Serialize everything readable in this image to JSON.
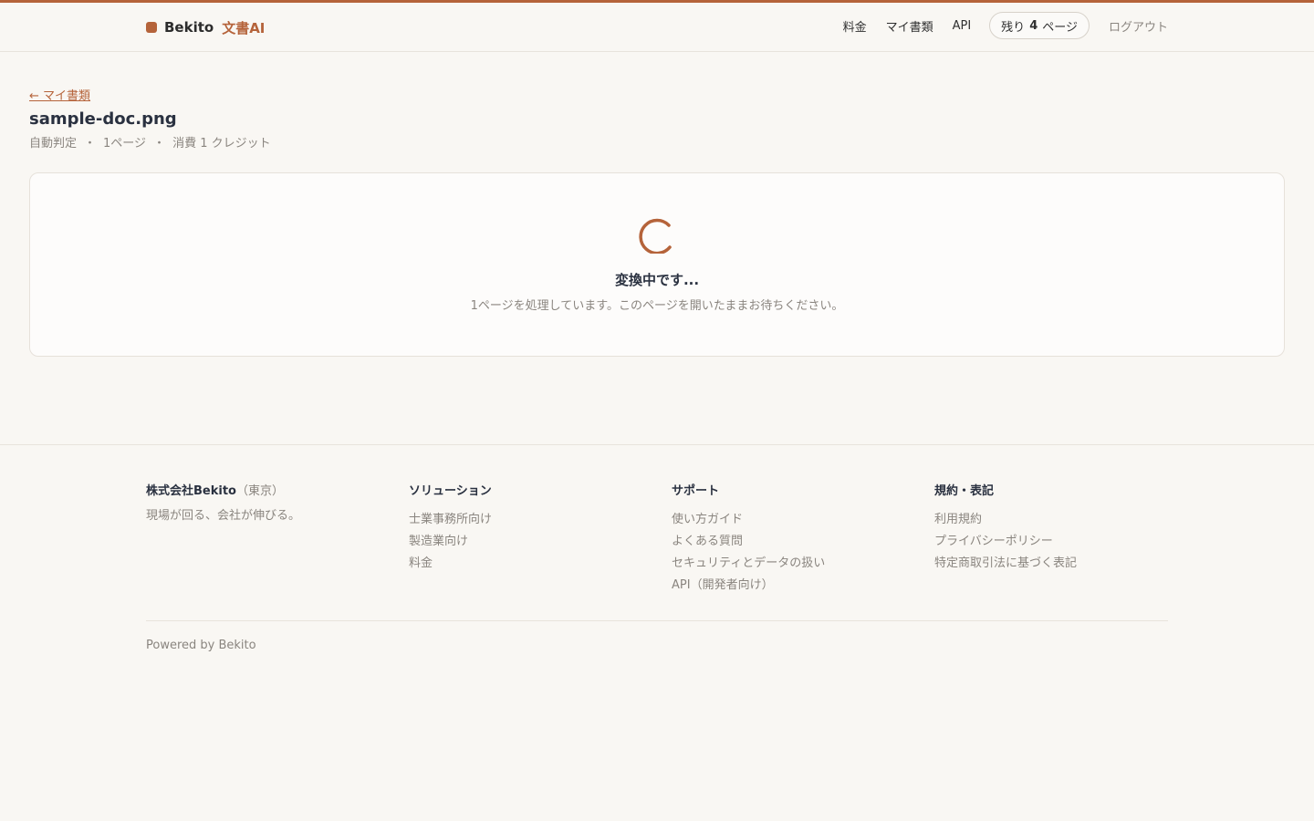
{
  "header": {
    "brand_name": "Bekito",
    "brand_sub": "文書AI",
    "nav": {
      "pricing": "料金",
      "my_docs": "マイ書類",
      "api": "API",
      "credits_prefix": "残り",
      "credits_count": "4",
      "credits_suffix": "ページ",
      "logout": "ログアウト"
    }
  },
  "page": {
    "back_link": "← マイ書類",
    "doc_title": "sample-doc.png",
    "meta": [
      "自動判定",
      "1ページ",
      "消費 1 クレジット"
    ],
    "meta_sep": "・"
  },
  "status": {
    "heading": "変換中です...",
    "description": "1ページを処理しています。このページを開いたままお待ちください。"
  },
  "footer": {
    "company_name": "株式会社Bekito",
    "company_location": "（東京）",
    "tagline": "現場が回る、会社が伸びる。",
    "columns": [
      {
        "title": "ソリューション",
        "links": [
          "士業事務所向け",
          "製造業向け",
          "料金"
        ]
      },
      {
        "title": "サポート",
        "links": [
          "使い方ガイド",
          "よくある質問",
          "セキュリティとデータの扱い",
          "API（開発者向け）"
        ]
      },
      {
        "title": "規約・表記",
        "links": [
          "利用規約",
          "プライバシーポリシー",
          "特定商取引法に基づく表記"
        ]
      }
    ],
    "powered_by": "Powered by Bekito"
  },
  "colors": {
    "accent": "#b5633a",
    "background": "#f9f7f3"
  }
}
